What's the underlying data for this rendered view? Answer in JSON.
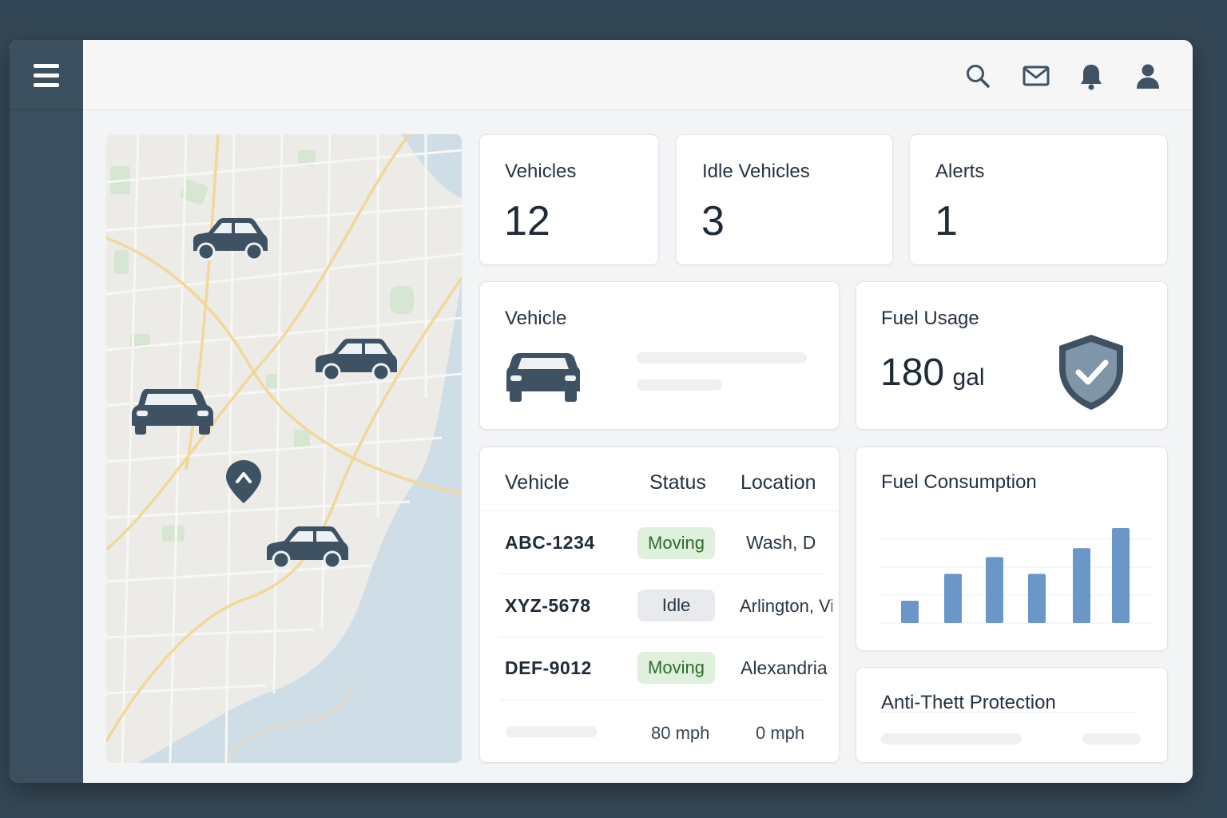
{
  "header": {
    "icons": [
      "search-icon",
      "mail-icon",
      "bell-icon",
      "user-icon"
    ]
  },
  "sidebar": {
    "icon": "hamburger-menu-icon"
  },
  "stats": {
    "vehicles": {
      "label": "Vehicles",
      "value": "12"
    },
    "idle": {
      "label": "Idle Vehicles",
      "value": "3"
    },
    "alerts": {
      "label": "Alerts",
      "value": "1"
    }
  },
  "vehicle_card": {
    "title": "Vehicle",
    "icon": "car-front-icon"
  },
  "fuel_usage": {
    "title": "Fuel Usage",
    "value": "180",
    "unit": "gal",
    "icon": "shield-check-icon"
  },
  "table": {
    "headers": [
      "Vehicle",
      "Status",
      "Location"
    ],
    "rows": [
      {
        "plate": "ABC-1234",
        "status": "Moving",
        "location": "Wash, D"
      },
      {
        "plate": "XYZ-5678",
        "status": "Idle",
        "location": "Arlington, Vi"
      },
      {
        "plate": "DEF-9012",
        "status": "Moving",
        "location": "Alexandria"
      }
    ],
    "footer": {
      "speed1": "80 mph",
      "speed2": "0 mph"
    }
  },
  "fuel_consumption": {
    "title": "Fuel Consumption"
  },
  "chart_data": {
    "type": "bar",
    "title": "Fuel Consumption",
    "categories": [
      "",
      "",
      "",
      "",
      "",
      ""
    ],
    "values": [
      20,
      44,
      59,
      44,
      67,
      85
    ],
    "ylim": [
      0,
      100
    ],
    "grid": true,
    "color": "#6a96c8"
  },
  "anti_theft": {
    "title": "Anti-Thett Protection"
  },
  "colors": {
    "sidebar": "#3c4f5e",
    "background": "#344756",
    "moving_badge": "#dff0dc",
    "idle_badge": "#e8eaed",
    "bar": "#6a96c8",
    "icon": "#3f5364"
  }
}
